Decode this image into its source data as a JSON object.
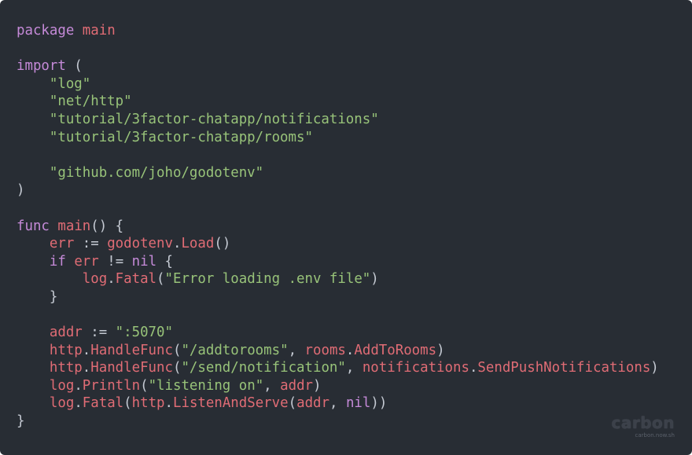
{
  "editor": {
    "language": "go",
    "theme_colors": {
      "background": "#282d34",
      "keyword": "#c58ad8",
      "string": "#98c379",
      "identifier": "#e06c75",
      "punctuation": "#c5cad3"
    },
    "lines": [
      [
        [
          "keyword",
          "package"
        ],
        [
          "plain",
          " "
        ],
        [
          "ident",
          "main"
        ]
      ],
      [],
      [
        [
          "keyword",
          "import"
        ],
        [
          "plain",
          " ("
        ]
      ],
      [
        [
          "plain",
          "    "
        ],
        [
          "string",
          "\"log\""
        ]
      ],
      [
        [
          "plain",
          "    "
        ],
        [
          "string",
          "\"net/http\""
        ]
      ],
      [
        [
          "plain",
          "    "
        ],
        [
          "string",
          "\"tutorial/3factor-chatapp/notifications\""
        ]
      ],
      [
        [
          "plain",
          "    "
        ],
        [
          "string",
          "\"tutorial/3factor-chatapp/rooms\""
        ]
      ],
      [],
      [
        [
          "plain",
          "    "
        ],
        [
          "string",
          "\"github.com/joho/godotenv\""
        ]
      ],
      [
        [
          "plain",
          ")"
        ]
      ],
      [],
      [
        [
          "keyword",
          "func"
        ],
        [
          "plain",
          " "
        ],
        [
          "ident",
          "main"
        ],
        [
          "plain",
          "() {"
        ]
      ],
      [
        [
          "plain",
          "    "
        ],
        [
          "ident",
          "err"
        ],
        [
          "plain",
          " := "
        ],
        [
          "ident",
          "godotenv"
        ],
        [
          "plain",
          "."
        ],
        [
          "ident",
          "Load"
        ],
        [
          "plain",
          "()"
        ]
      ],
      [
        [
          "plain",
          "    "
        ],
        [
          "keyword",
          "if"
        ],
        [
          "plain",
          " "
        ],
        [
          "ident",
          "err"
        ],
        [
          "plain",
          " != "
        ],
        [
          "keyword",
          "nil"
        ],
        [
          "plain",
          " {"
        ]
      ],
      [
        [
          "plain",
          "        "
        ],
        [
          "ident",
          "log"
        ],
        [
          "plain",
          "."
        ],
        [
          "ident",
          "Fatal"
        ],
        [
          "plain",
          "("
        ],
        [
          "string",
          "\"Error loading .env file\""
        ],
        [
          "plain",
          ")"
        ]
      ],
      [
        [
          "plain",
          "    }"
        ]
      ],
      [],
      [
        [
          "plain",
          "    "
        ],
        [
          "ident",
          "addr"
        ],
        [
          "plain",
          " := "
        ],
        [
          "string",
          "\":5070\""
        ]
      ],
      [
        [
          "plain",
          "    "
        ],
        [
          "ident",
          "http"
        ],
        [
          "plain",
          "."
        ],
        [
          "ident",
          "HandleFunc"
        ],
        [
          "plain",
          "("
        ],
        [
          "string",
          "\"/addtorooms\""
        ],
        [
          "plain",
          ", "
        ],
        [
          "ident",
          "rooms"
        ],
        [
          "plain",
          "."
        ],
        [
          "ident",
          "AddToRooms"
        ],
        [
          "plain",
          ")"
        ]
      ],
      [
        [
          "plain",
          "    "
        ],
        [
          "ident",
          "http"
        ],
        [
          "plain",
          "."
        ],
        [
          "ident",
          "HandleFunc"
        ],
        [
          "plain",
          "("
        ],
        [
          "string",
          "\"/send/notification\""
        ],
        [
          "plain",
          ", "
        ],
        [
          "ident",
          "notifications"
        ],
        [
          "plain",
          "."
        ],
        [
          "ident",
          "SendPushNotifications"
        ],
        [
          "plain",
          ")"
        ]
      ],
      [
        [
          "plain",
          "    "
        ],
        [
          "ident",
          "log"
        ],
        [
          "plain",
          "."
        ],
        [
          "ident",
          "Println"
        ],
        [
          "plain",
          "("
        ],
        [
          "string",
          "\"listening on\""
        ],
        [
          "plain",
          ", "
        ],
        [
          "ident",
          "addr"
        ],
        [
          "plain",
          ")"
        ]
      ],
      [
        [
          "plain",
          "    "
        ],
        [
          "ident",
          "log"
        ],
        [
          "plain",
          "."
        ],
        [
          "ident",
          "Fatal"
        ],
        [
          "plain",
          "("
        ],
        [
          "ident",
          "http"
        ],
        [
          "plain",
          "."
        ],
        [
          "ident",
          "ListenAndServe"
        ],
        [
          "plain",
          "("
        ],
        [
          "ident",
          "addr"
        ],
        [
          "plain",
          ", "
        ],
        [
          "keyword",
          "nil"
        ],
        [
          "plain",
          "))"
        ]
      ],
      [
        [
          "plain",
          "}"
        ]
      ]
    ]
  },
  "watermark": {
    "brand": "carbon",
    "url": "carbon.now.sh"
  }
}
